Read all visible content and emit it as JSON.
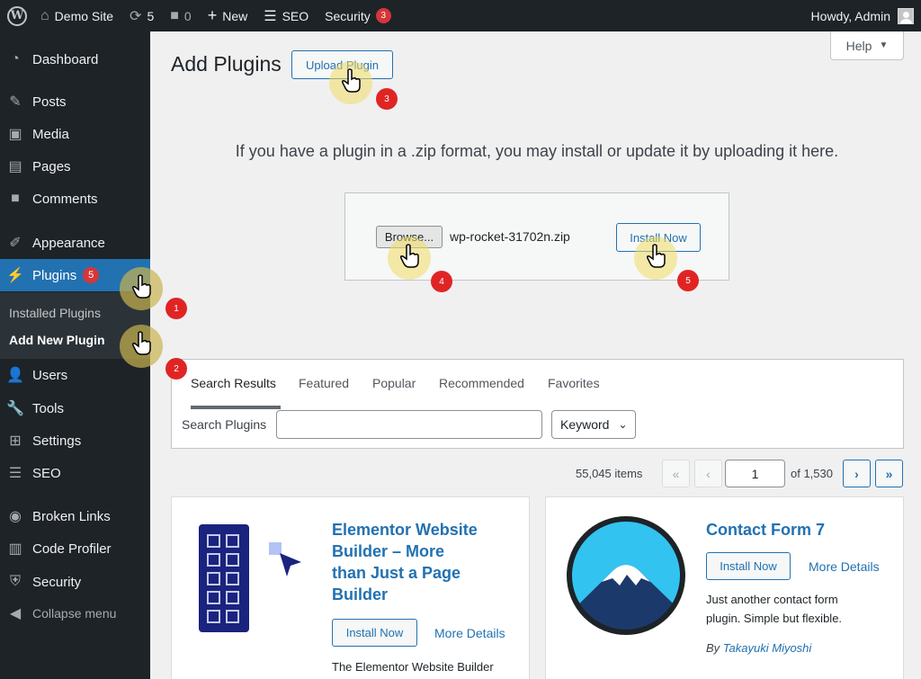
{
  "adminbar": {
    "site_name": "Demo Site",
    "updates_count": "5",
    "comments_count": "0",
    "new_label": "New",
    "seo_label": "SEO",
    "security_label": "Security",
    "security_badge": "3",
    "howdy": "Howdy, Admin"
  },
  "sidebar": {
    "items": [
      {
        "label": "Dashboard",
        "icon": "dashboard-icon"
      },
      {
        "label": "Posts",
        "icon": "pin-icon"
      },
      {
        "label": "Media",
        "icon": "media-icon"
      },
      {
        "label": "Pages",
        "icon": "pages-icon"
      },
      {
        "label": "Comments",
        "icon": "comment-icon"
      },
      {
        "label": "Appearance",
        "icon": "brush-icon"
      },
      {
        "label": "Plugins",
        "icon": "plugin-icon",
        "badge": "5"
      },
      {
        "label": "Users",
        "icon": "users-icon"
      },
      {
        "label": "Tools",
        "icon": "wrench-icon"
      },
      {
        "label": "Settings",
        "icon": "settings-icon"
      },
      {
        "label": "SEO",
        "icon": "seo-icon"
      },
      {
        "label": "Broken Links",
        "icon": "link-icon"
      },
      {
        "label": "Code Profiler",
        "icon": "chart-icon"
      },
      {
        "label": "Security",
        "icon": "shield-icon"
      }
    ],
    "submenu": [
      "Installed Plugins",
      "Add New Plugin"
    ],
    "collapse": "Collapse menu"
  },
  "help_label": "Help",
  "page": {
    "title": "Add Plugins",
    "upload_button": "Upload Plugin",
    "upload_message": "If you have a plugin in a .zip format, you may install or update it by uploading it here.",
    "browse_button": "Browse...",
    "file_name": "wp-rocket-31702n.zip",
    "install_button": "Install Now"
  },
  "filters": {
    "tabs": [
      "Search Results",
      "Featured",
      "Popular",
      "Recommended",
      "Favorites"
    ],
    "search_label": "Search Plugins",
    "search_value": "",
    "type_select": "Keyword"
  },
  "pagination": {
    "items": "55,045 items",
    "first": "«",
    "prev": "‹",
    "current": "1",
    "of": "of 1,530",
    "next": "›",
    "last": "»"
  },
  "plugins": [
    {
      "title_lines": [
        "Elementor Website",
        "Builder – More",
        "than Just a Page",
        "Builder"
      ],
      "install": "Install Now",
      "more": "More Details",
      "desc": "The Elementor Website Builder"
    },
    {
      "title": "Contact Form 7",
      "install": "Install Now",
      "more": "More Details",
      "desc_lines": [
        "Just another contact form",
        "plugin. Simple but flexible."
      ],
      "author_prefix": "By",
      "author": "Takayuki Miyoshi"
    }
  ],
  "steps": [
    "1",
    "2",
    "3",
    "4",
    "5"
  ],
  "colors": {
    "admin_dark": "#1d2327",
    "accent": "#2271b1",
    "badge": "#d63638"
  }
}
